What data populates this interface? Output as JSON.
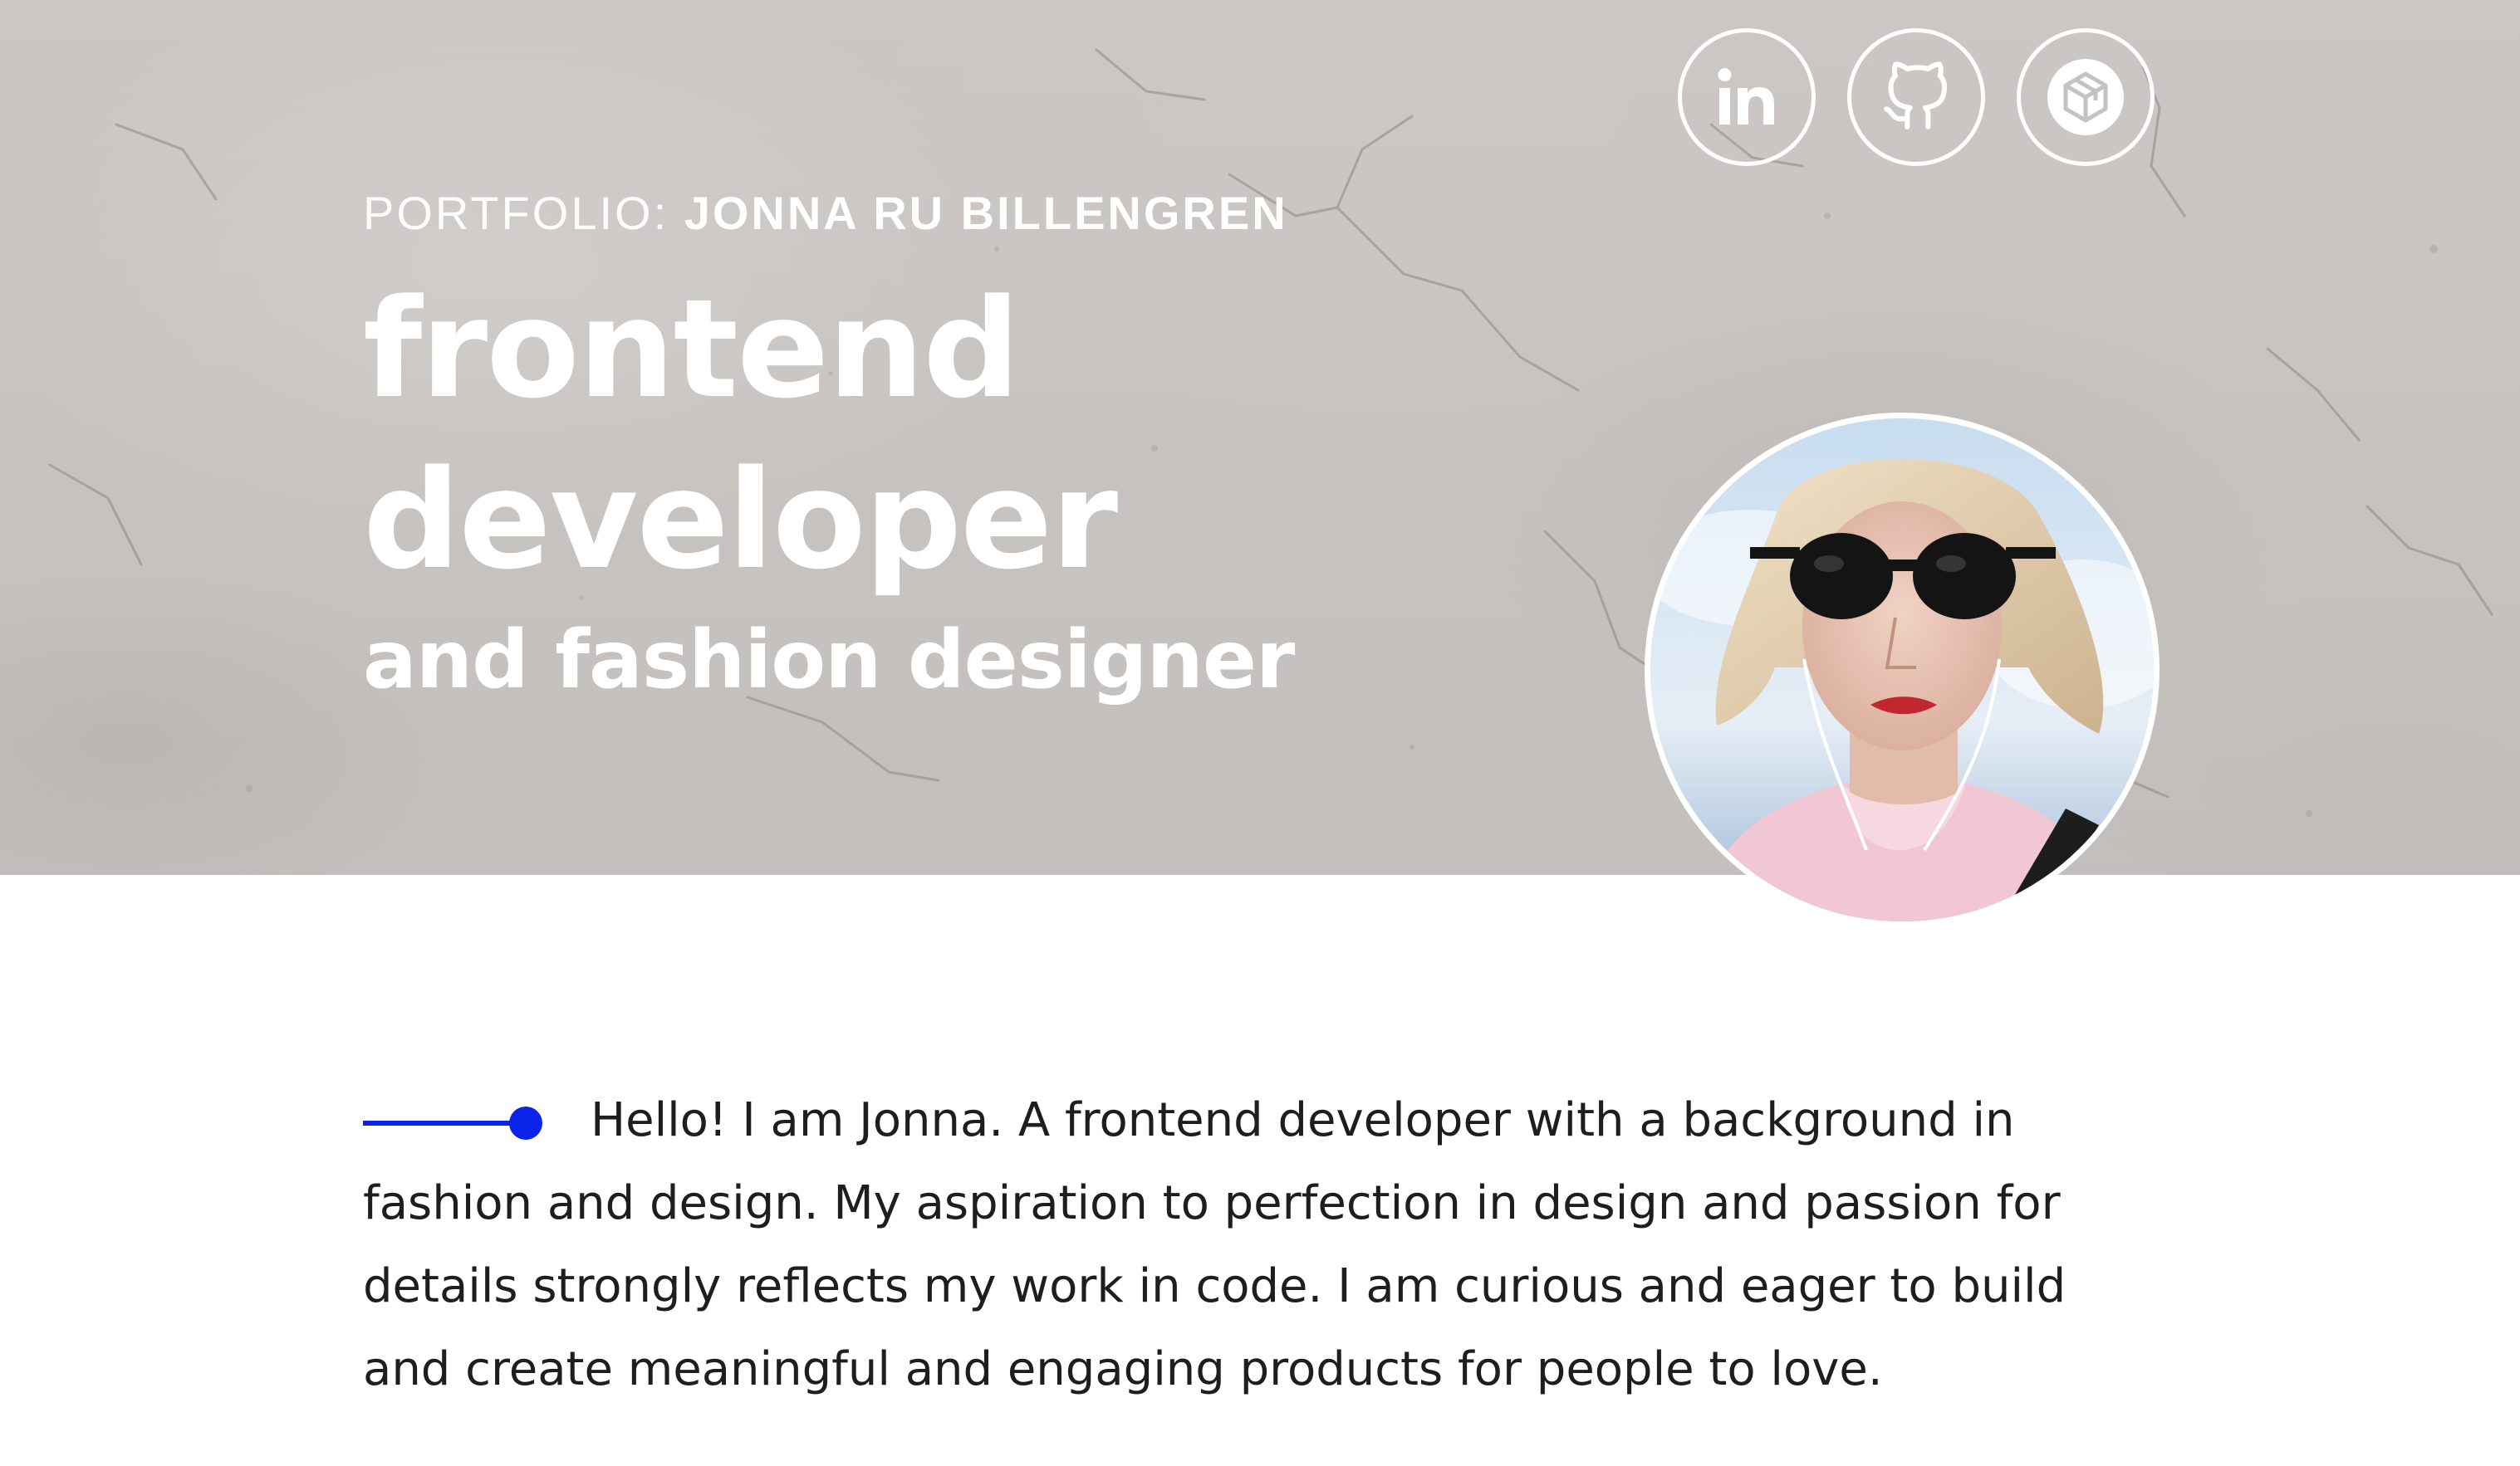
{
  "hero": {
    "eyebrow_label": "PORTFOLIO: ",
    "eyebrow_name": "JONNA RU BILLENGREN",
    "headline_line1": "frontend",
    "headline_line2": "developer",
    "subheadline": "and fashion designer"
  },
  "social": {
    "linkedin_label": "in",
    "github_icon": "github-icon",
    "codepen_icon": "codepen-icon"
  },
  "avatar": {
    "icon": "portrait-photo"
  },
  "about": {
    "text": "Hello! I am Jonna. A frontend developer with a background in fashion and design. My aspiration to perfection in design and passion for details strongly reflects my work in code. I am curious and eager to build and create meaningful and engaging products for people to love."
  },
  "colors": {
    "accent": "#0a23e6",
    "text": "#1e1e1e",
    "hero_text": "#ffffff",
    "hero_background": "#c6c2bf"
  }
}
